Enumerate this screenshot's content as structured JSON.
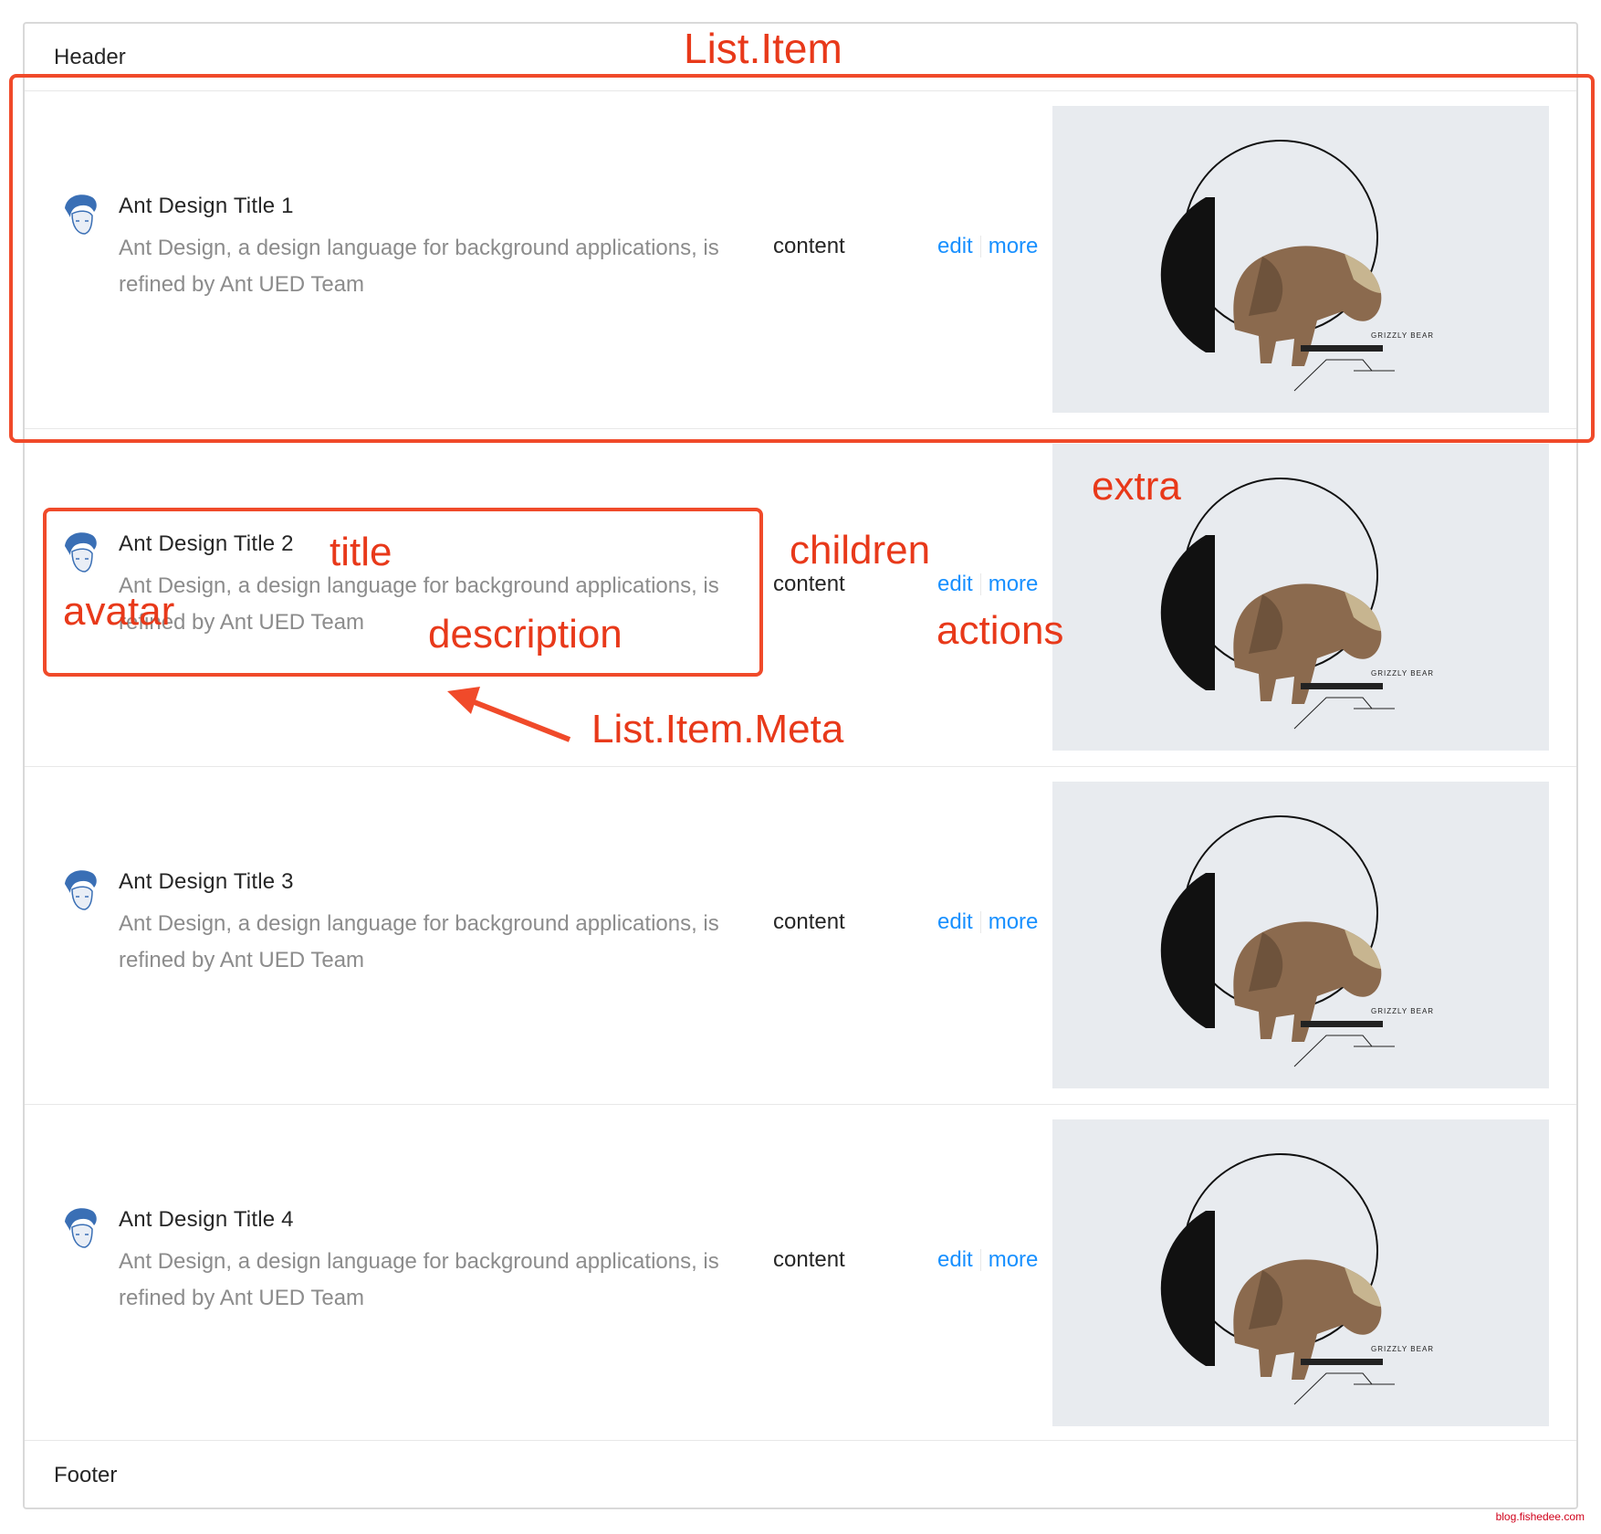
{
  "list": {
    "header": "Header",
    "footer": "Footer",
    "items": [
      {
        "title": "Ant Design Title 1",
        "description": "Ant Design, a design language for background applications, is refined by Ant UED Team",
        "content": "content",
        "actions": [
          "edit",
          "more"
        ],
        "extra_image_caption": "GRIZZLY BEAR"
      },
      {
        "title": "Ant Design Title 2",
        "description": "Ant Design, a design language for background applications, is refined by Ant UED Team",
        "content": "content",
        "actions": [
          "edit",
          "more"
        ],
        "extra_image_caption": "GRIZZLY BEAR"
      },
      {
        "title": "Ant Design Title 3",
        "description": "Ant Design, a design language for background applications, is refined by Ant UED Team",
        "content": "content",
        "actions": [
          "edit",
          "more"
        ],
        "extra_image_caption": "GRIZZLY BEAR"
      },
      {
        "title": "Ant Design Title 4",
        "description": "Ant Design, a design language for background applications, is refined by Ant UED Team",
        "content": "content",
        "actions": [
          "edit",
          "more"
        ],
        "extra_image_caption": "GRIZZLY BEAR"
      }
    ]
  },
  "annotations": {
    "list_item": "List.Item",
    "extra": "extra",
    "title": "title",
    "children": "children",
    "avatar": "avatar",
    "actions": "actions",
    "description": "description",
    "list_item_meta": "List.Item.Meta"
  },
  "credit": "blog.fishedee.com",
  "colors": {
    "annotation": "#e8391a",
    "link": "#1890ff",
    "description": "#8c8c8c",
    "extra_background": "#e8ebef"
  }
}
